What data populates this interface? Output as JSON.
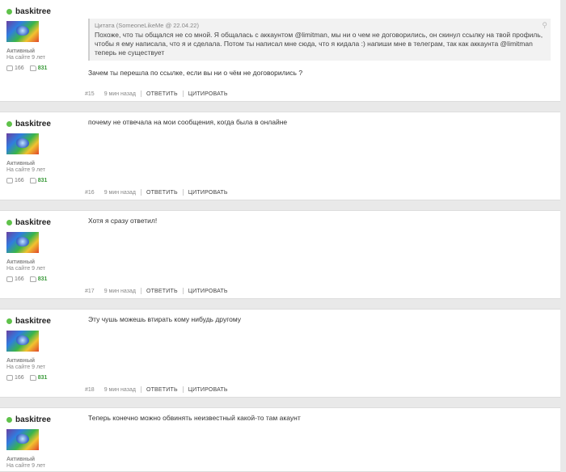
{
  "common": {
    "username": "baskitree",
    "status": "Активный",
    "since": "На сайте 9 лет",
    "messages": "166",
    "likes": "831",
    "time": "9 мин назад",
    "reply_label": "ОТВЕТИТЬ",
    "quote_label": "ЦИТИРОВАТЬ"
  },
  "posts": [
    {
      "number": "#15",
      "quote_head": "Цитата (SomeoneLikeMe @ 22.04.22)",
      "quote_text": "Похоже, что ты общался не со мной. Я общалась с аккаунтом @limitman, мы ни о чем не договорились, он скинул ссылку на твой профиль, чтобы я ему написала, что я и сделала. Потом ты написал мне сюда, что я кидала :) напиши мне в телеграм, так как аккаунта @limitman теперь не существует",
      "text": "Зачем ты перешла по ссылке, если вы ни о чём не договорились ?"
    },
    {
      "number": "#16",
      "text": "почему не отвечала на мои сообщения, когда была в онлайне"
    },
    {
      "number": "#17",
      "text": "Хотя я сразу ответил!"
    },
    {
      "number": "#18",
      "text": "Эту чушь можешь втирать кому нибудь другому"
    },
    {
      "text": "Теперь конечно можно обвинять неизвестный какой-то там акаунт"
    }
  ]
}
